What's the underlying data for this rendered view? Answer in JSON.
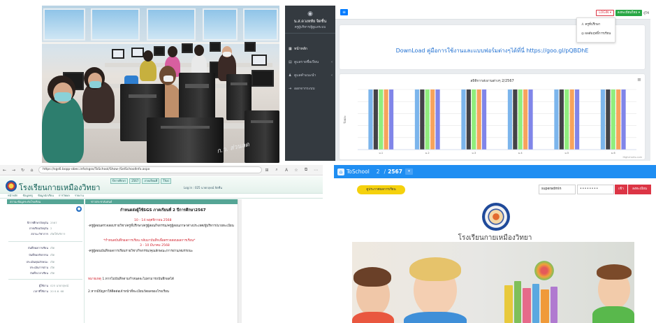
{
  "photo": {
    "sticker_text": "ก.ว. ส่วนลด"
  },
  "dashboard": {
    "brand_name": "น.ส.ดวงหทัย จิตชื่น",
    "brand_role": "ครูผู้บริหาร/ผู้ดูแลระบบ",
    "menu": [
      {
        "icon": "home-icon",
        "label": "หน้าหลัก",
        "active": true
      },
      {
        "icon": "book-icon",
        "label": "ดูแลรายชื่อเรียน",
        "active": false
      },
      {
        "icon": "people-icon",
        "label": "ดูแลคำแนะนำ",
        "active": false
      },
      {
        "icon": "logout-icon",
        "label": "ออกจากระบบ",
        "active": false
      }
    ],
    "login_label": "LOGIN ▾",
    "register_label": "ลงทะเบียนใหม่ ▾",
    "user_label": "ผู้ใช้",
    "dropdown_items": [
      "ครูที่ปรึกษา",
      "ผลสัมฤทธิ์การเรียน"
    ],
    "download_text": "DownLoad คู่มือการใช้งานและแบบฟอร์มต่างๆได้ที่นี่ https://goo.gl/pQBDhE",
    "credit": "Highcharts.com"
  },
  "chart_data": {
    "type": "bar",
    "title": "สถิติการส่งงานต่างๆ 2/2567",
    "ylabel": "ร้อยละ",
    "ylim": [
      0,
      100
    ],
    "categories": [
      "ม.1",
      "ม.2",
      "ม.3",
      "ม.4",
      "ม.5",
      "ม.6"
    ],
    "series": [
      {
        "color": "#7cb5ec",
        "values": [
          100,
          100,
          100,
          100,
          100,
          100
        ]
      },
      {
        "color": "#434348",
        "values": [
          100,
          100,
          100,
          100,
          100,
          100
        ]
      },
      {
        "color": "#90ed7d",
        "values": [
          100,
          100,
          100,
          100,
          100,
          100
        ]
      },
      {
        "color": "#f7a35c",
        "values": [
          100,
          100,
          100,
          100,
          100,
          100
        ]
      },
      {
        "color": "#8085e9",
        "values": [
          100,
          100,
          100,
          100,
          100,
          100
        ]
      }
    ]
  },
  "legacy": {
    "url": "https://sgs6.bopp-obec.info/sgss/ToSchool/Show-/SelSchoolInfo.aspx",
    "school_name": "โรงเรียนกายเหมืองวิทยา",
    "form_fields": [
      "ปีการศึกษา",
      "2567",
      "ภาคเรียนที่",
      "Thai"
    ],
    "login_status": "Log in : 025 นายกฤษณ์ จิตชื่น",
    "menu_text": "หน้าหลัก  ข้อมูลครู  ข้อมูลนักเรียน  การวัดผล  รายงาน",
    "left_head": "สถานะข้อมูลระดับโรงเรียน",
    "left_rows": [
      {
        "k": "ปีการศึกษาปัจจุบัน",
        "v": "2567"
      },
      {
        "k": "ภาคเรียนปัจจุบัน",
        "v": "2"
      },
      {
        "k": "สถานะวิชาการ",
        "v": "เปิดให้บริการ"
      },
      {
        "k": "บันทึกผลการเรียน",
        "v": "เปิด"
      },
      {
        "k": "บันทึกผลกิจกรรม",
        "v": "เปิด"
      },
      {
        "k": "ประเมินคุณลักษณะ",
        "v": "เปิด"
      },
      {
        "k": "ประเมินการอ่าน",
        "v": "เปิด"
      },
      {
        "k": "บันทึกเวลาเรียน",
        "v": "เปิด"
      },
      {
        "k": "ผู้ใช้งาน",
        "v": "025 นายกฤษณ์"
      },
      {
        "k": "เวลาที่ใช้งาน",
        "v": "20 ธ.ค. 68"
      }
    ],
    "main_head": "ข่าวประชาสัมพันธ์",
    "notice_title": "กำหนดส่งผู้ใช้SGS ภาคเรียนที่ 2 ปีการศึกษา2567",
    "notice_date1": "10 - 14 พฤศจิกายน 2568",
    "notice_text1": "-ครูผู้สอนตรวจสอบรายวิชา/ครูที่ปรึกษา/ครูผู้สอนกิจกรรม/ครูผู้สอนภาษาต่างประเทศ/ผู้บริหาร/นายทะเบียน",
    "notice_heading2": "*กำหนดบันทึกผลการเรียน กลับมาบันทึกเพื่อตรวจสอบผลการเรียน*",
    "notice_date2": "3 - 10 มีนาคม 2568",
    "notice_text2": "-ครูผู้สอนบันทึกผลการเรียนรายวิชา/กิจกรรม/คุณลักษณะ/การอ่าน/สมรรถนะ",
    "notice_label3": "หมายเหตุ",
    "notice_text3": "1.หากไม่บันทึกตามกำหนดจะไม่สามารถบันทึกผลได้",
    "notice_text4": "2.หากมีปัญหาให้ติดต่อเจ้าหน้าที่ทะเบียนวัดผลของโรงเรียน"
  },
  "toschool": {
    "app_name": "ToSchool",
    "term": "2",
    "year": "2567",
    "button_label": "ดูประกาศผลการเรียน",
    "username": "superadmin",
    "password": "••••••••",
    "go_label": "เข้า",
    "register_label": "ลงทะเบียน",
    "school_name": "โรงเรียนกายเหมืองวิทยา"
  },
  "colors": {
    "toschool_blue": "#1f8ef2",
    "legacy_green": "#55a595",
    "dashboard_sidebar": "#343a40",
    "danger_red": "#dc3545"
  }
}
